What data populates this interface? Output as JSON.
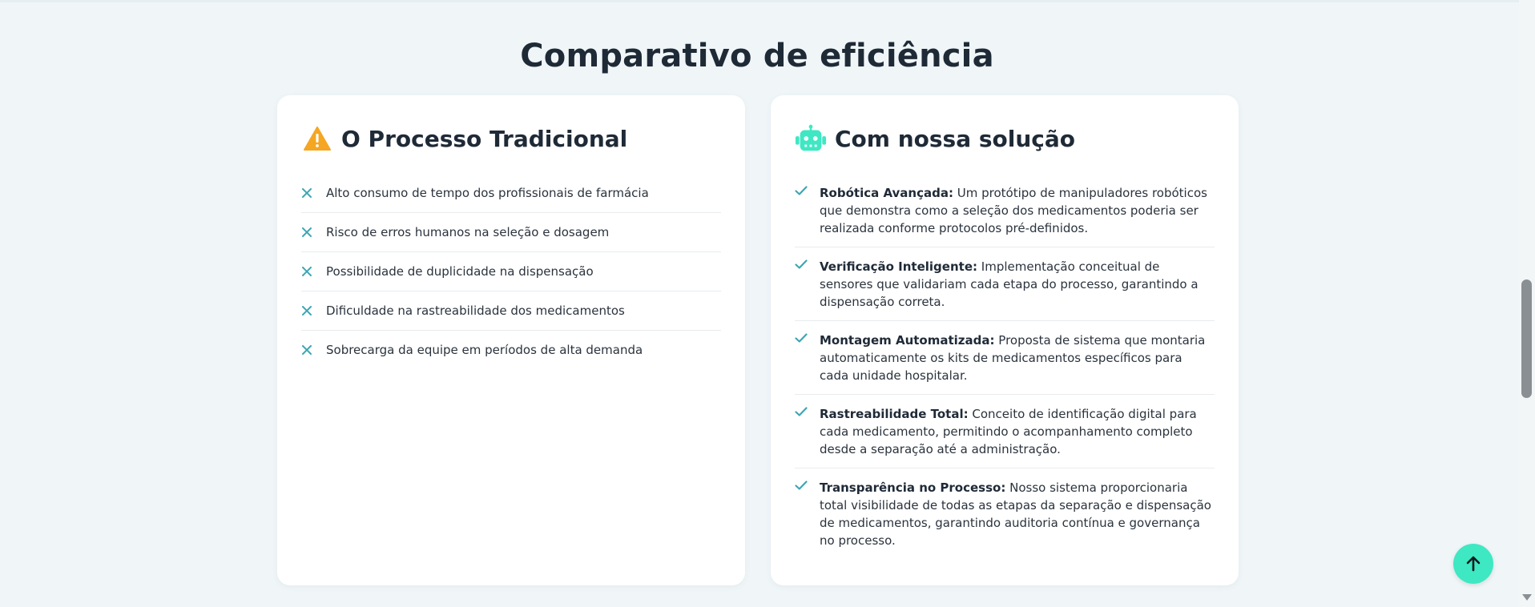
{
  "section_title": "Comparativo de eficiência",
  "traditional": {
    "icon": "warning-icon",
    "title": "O Processo Tradicional",
    "items": [
      "Alto consumo de tempo dos profissionais de farmácia",
      "Risco de erros humanos na seleção e dosagem",
      "Possibilidade de duplicidade na dispensação",
      "Dificuldade na rastreabilidade dos medicamentos",
      "Sobrecarga da equipe em períodos de alta demanda"
    ]
  },
  "solution": {
    "icon": "robot-icon",
    "title": "Com nossa solução",
    "items": [
      {
        "label": "Robótica Avançada:",
        "text": "Um protótipo de manipuladores robóticos que demonstra como a seleção dos medicamentos poderia ser realizada conforme protocolos pré-definidos."
      },
      {
        "label": "Verificação Inteligente:",
        "text": "Implementação conceitual de sensores que validariam cada etapa do processo, garantindo a dispensação correta."
      },
      {
        "label": "Montagem Automatizada:",
        "text": "Proposta de sistema que montaria automaticamente os kits de medicamentos específicos para cada unidade hospitalar."
      },
      {
        "label": "Rastreabilidade Total:",
        "text": "Conceito de identificação digital para cada medicamento, permitindo o acompanhamento completo desde a separação até a administração."
      },
      {
        "label": "Transparência no Processo:",
        "text": "Nosso sistema proporcionaria total visibilidade de todas as etapas da separação e dispensação de medicamentos, garantindo auditoria contínua e governança no processo."
      }
    ]
  },
  "colors": {
    "accent": "#3ee8c3",
    "warning": "#f5a623",
    "mark": "#3ea6b4",
    "background": "#f0f6f8"
  },
  "back_to_top_icon": "arrow-up-icon"
}
